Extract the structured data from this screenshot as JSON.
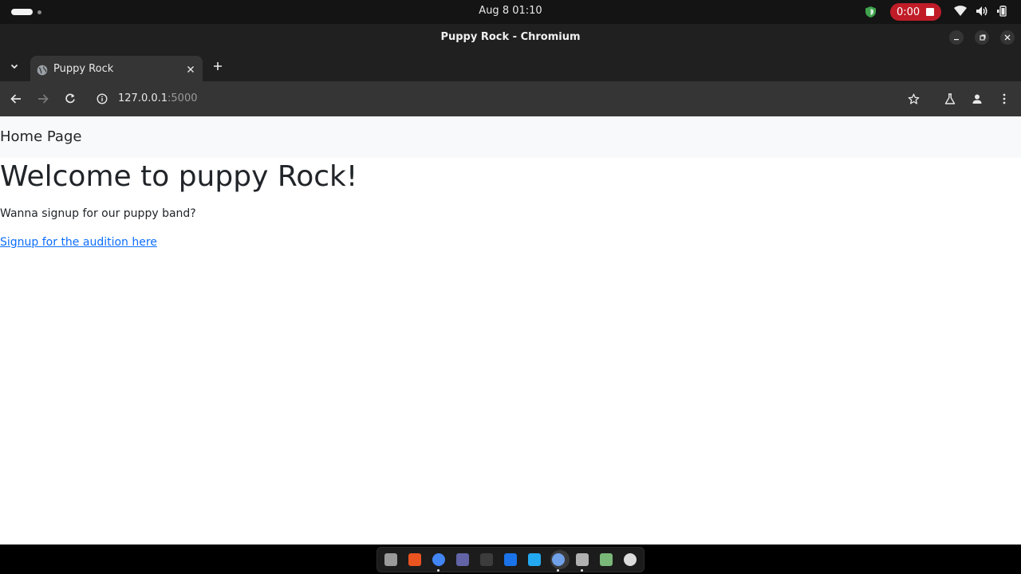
{
  "system": {
    "clock": "Aug 8  01:10",
    "recording_time": "0:00"
  },
  "window": {
    "title": "Puppy Rock - Chromium"
  },
  "tabs": [
    {
      "title": "Puppy Rock"
    }
  ],
  "address_bar": {
    "host": "127.0.0.1",
    "port": ":5000"
  },
  "page": {
    "navbar_brand": "Home Page",
    "heading": "Welcome to puppy Rock!",
    "paragraph": "Wanna signup for our puppy band?",
    "link_text": "Signup for the audition here"
  },
  "dock": {
    "apps": [
      {
        "icon": "files-icon",
        "color": "#9a9a9a"
      },
      {
        "icon": "app-center-icon",
        "color": "#e95420"
      },
      {
        "icon": "chrome-icon",
        "color": "#4285f4"
      },
      {
        "icon": "teams-icon",
        "color": "#6264a7"
      },
      {
        "icon": "terminal-icon",
        "color": "#3c3c3c"
      },
      {
        "icon": "thunderbird-icon",
        "color": "#1a73e8"
      },
      {
        "icon": "vscode-icon",
        "color": "#23a9f2"
      },
      {
        "icon": "chromium-icon",
        "color": "#6fa0e8"
      },
      {
        "icon": "screenshot-tool-icon",
        "color": "#b0b0b0"
      },
      {
        "icon": "trash-icon",
        "color": "#7ab87a"
      },
      {
        "icon": "updater-icon",
        "color": "#dcdcdc"
      }
    ]
  },
  "colors": {
    "link": "#0d6efd",
    "record": "#c01c28",
    "navbar_bg": "#f8f9fa"
  }
}
